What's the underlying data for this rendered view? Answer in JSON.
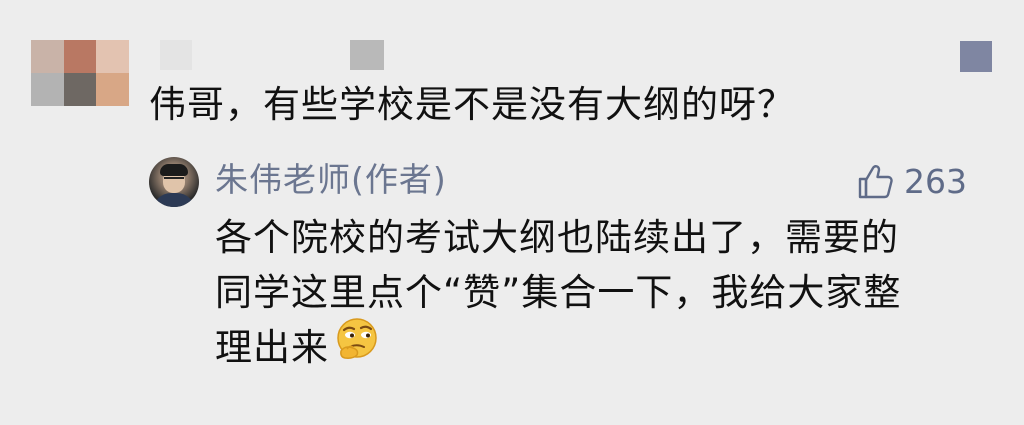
{
  "comment": {
    "text": "伟哥，有些学校是不是没有大纲的呀？",
    "avatar_pixels": [
      "#c9b3a8",
      "#b97863",
      "#e3c3b1",
      "#b3b3b3",
      "#6e6863",
      "#d8a786"
    ]
  },
  "reply": {
    "author": "朱伟老师(作者)",
    "like_count": "263",
    "lines": [
      "各个院校的考试大纲也陆续出了，需要的",
      "同学这里点个“赞”集合一下，我给大家整",
      "理出来"
    ],
    "emoji": "thinking-face"
  },
  "icons": {
    "like": "thumbs-up-icon",
    "emoji": "thinking-emoji-icon"
  },
  "colors": {
    "background": "#ededed",
    "author": "#6b7690",
    "like": "#5f6b88",
    "text": "#111111"
  }
}
